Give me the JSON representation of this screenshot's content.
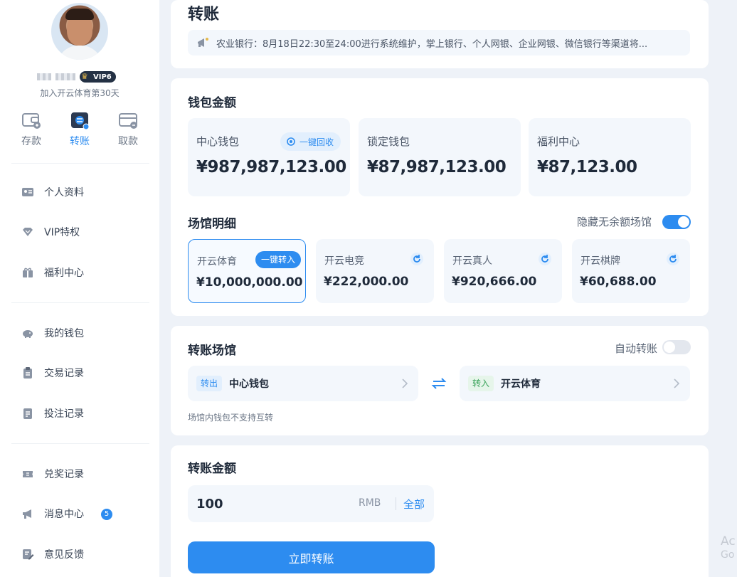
{
  "user": {
    "vip_label": "VIP6",
    "joined_text": "加入开云体育第30天"
  },
  "quick_actions": [
    {
      "label": "存款",
      "icon": "wallet-deposit-icon"
    },
    {
      "label": "转账",
      "icon": "transfer-icon"
    },
    {
      "label": "取款",
      "icon": "card-withdraw-icon"
    }
  ],
  "menu": [
    {
      "label": "个人资料",
      "icon": "id-card-icon"
    },
    {
      "label": "VIP特权",
      "icon": "diamond-icon"
    },
    {
      "label": "福利中心",
      "icon": "gift-icon"
    },
    {
      "label": "我的钱包",
      "icon": "piggy-bank-icon"
    },
    {
      "label": "交易记录",
      "icon": "clipboard-icon"
    },
    {
      "label": "投注记录",
      "icon": "document-icon"
    },
    {
      "label": "兑奖记录",
      "icon": "ticket-icon"
    },
    {
      "label": "消息中心",
      "icon": "megaphone-icon",
      "badge": "5"
    },
    {
      "label": "意见反馈",
      "icon": "feedback-icon"
    }
  ],
  "page": {
    "title": "转账",
    "notice": "农业银行：8月18日22:30至24:00进行系统维护，掌上银行、个人网银、企业网银、微信银行等渠道将..."
  },
  "wallet": {
    "section_title": "钱包金额",
    "recall_label": "一键回收",
    "boxes": [
      {
        "label": "中心钱包",
        "value": "¥987,987,123.00"
      },
      {
        "label": "锁定钱包",
        "value": "¥87,987,123.00"
      },
      {
        "label": "福利中心",
        "value": "¥87,123.00"
      }
    ]
  },
  "venues": {
    "section_title": "场馆明细",
    "hide_empty_label": "隐藏无余额场馆",
    "hide_empty_on": true,
    "transfer_in_label": "一键转入",
    "items": [
      {
        "label": "开云体育",
        "value": "¥10,000,000.00"
      },
      {
        "label": "开云电竞",
        "value": "¥222,000.00"
      },
      {
        "label": "开云真人",
        "value": "¥920,666.00"
      },
      {
        "label": "开云棋牌",
        "value": "¥60,688.00"
      }
    ]
  },
  "transfer": {
    "section_title": "转账场馆",
    "auto_label": "自动转账",
    "auto_on": false,
    "out_tag": "转出",
    "out_value": "中心钱包",
    "in_tag": "转入",
    "in_value": "开云体育",
    "hint": "场馆内钱包不支持互转"
  },
  "amount": {
    "section_title": "转账金额",
    "value": "100",
    "unit": "RMB",
    "all_label": "全部",
    "submit_label": "立即转账"
  },
  "watermark": {
    "line1": "Ac",
    "line2": "Go"
  },
  "colors": {
    "accent": "#2d8cf0",
    "in_green": "#3aa35a"
  }
}
